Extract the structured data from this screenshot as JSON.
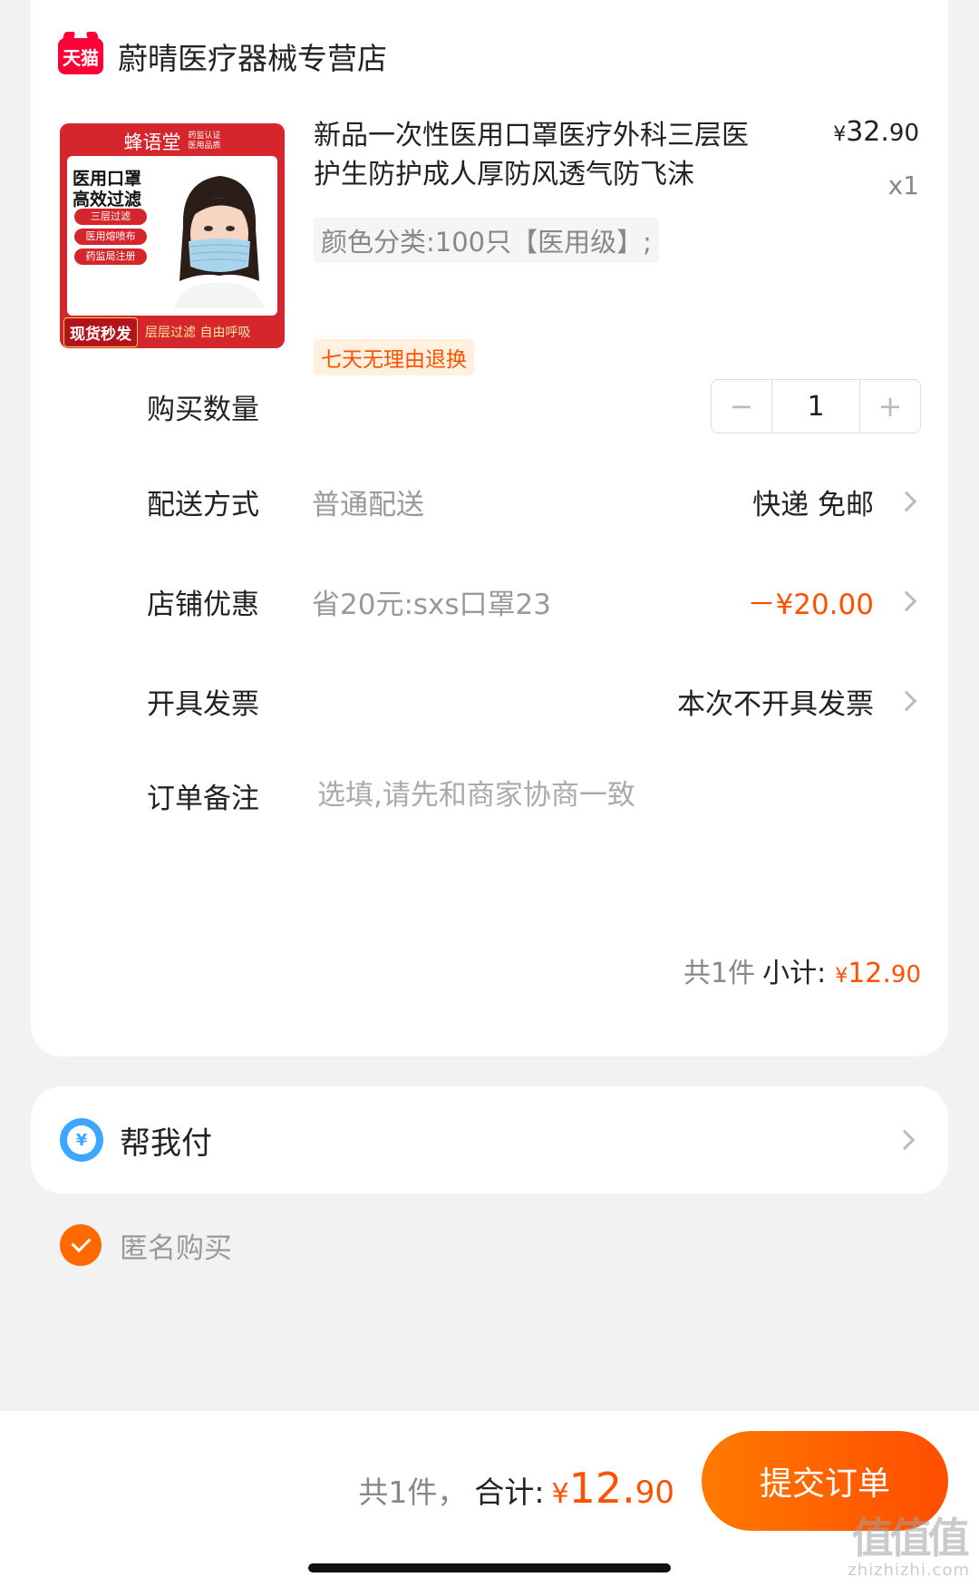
{
  "shop": {
    "platform_logo": "天猫",
    "name": "蔚晴医疗器械专营店"
  },
  "product": {
    "image": {
      "brand": "蜂语堂",
      "cert_line1": "药监认证",
      "cert_line2": "医用品质",
      "title_line1": "医用口罩",
      "title_line2": "高效过滤",
      "tags": [
        "三层过滤",
        "医用熔喷布",
        "药监局注册"
      ],
      "badge": "现货秒发",
      "slogan": "层层过滤 自由呼吸"
    },
    "title": "新品一次性医用口罩医疗外科三层医护生防护成人厚防风透气防飞沫",
    "price_currency": "¥",
    "price_int": "32.",
    "price_dec": "90",
    "quantity_label": "x1",
    "sku": "颜色分类:100只【医用级】;",
    "return_policy": "七天无理由退换"
  },
  "rows": {
    "quantity": {
      "label": "购买数量",
      "minus": "−",
      "value": "1",
      "plus": "+"
    },
    "delivery": {
      "label": "配送方式",
      "sub": "普通配送",
      "value": "快递 免邮"
    },
    "discount": {
      "label": "店铺优惠",
      "sub": "省20元:sxs口罩23",
      "value": "－¥20.00"
    },
    "invoice": {
      "label": "开具发票",
      "value": "本次不开具发票"
    },
    "remark": {
      "label": "订单备注",
      "placeholder": "选填,请先和商家协商一致"
    }
  },
  "subtotal": {
    "count": "共1件",
    "label": "小计:",
    "currency": "¥",
    "int": "12.",
    "dec": "90"
  },
  "help_pay": {
    "icon_glyph": "¥",
    "label": "帮我付"
  },
  "anonymous": {
    "label": "匿名购买",
    "checked": true
  },
  "footer": {
    "count": "共1件，",
    "label": "合计:",
    "currency": "¥",
    "int": "12.",
    "dec": "90",
    "submit": "提交订单"
  },
  "watermark": {
    "big": "值值值",
    "small": "zhizhizhi.com"
  },
  "colors": {
    "accent": "#ff5000",
    "tmall_red": "#ff0036",
    "help_blue": "#3da6ff"
  }
}
